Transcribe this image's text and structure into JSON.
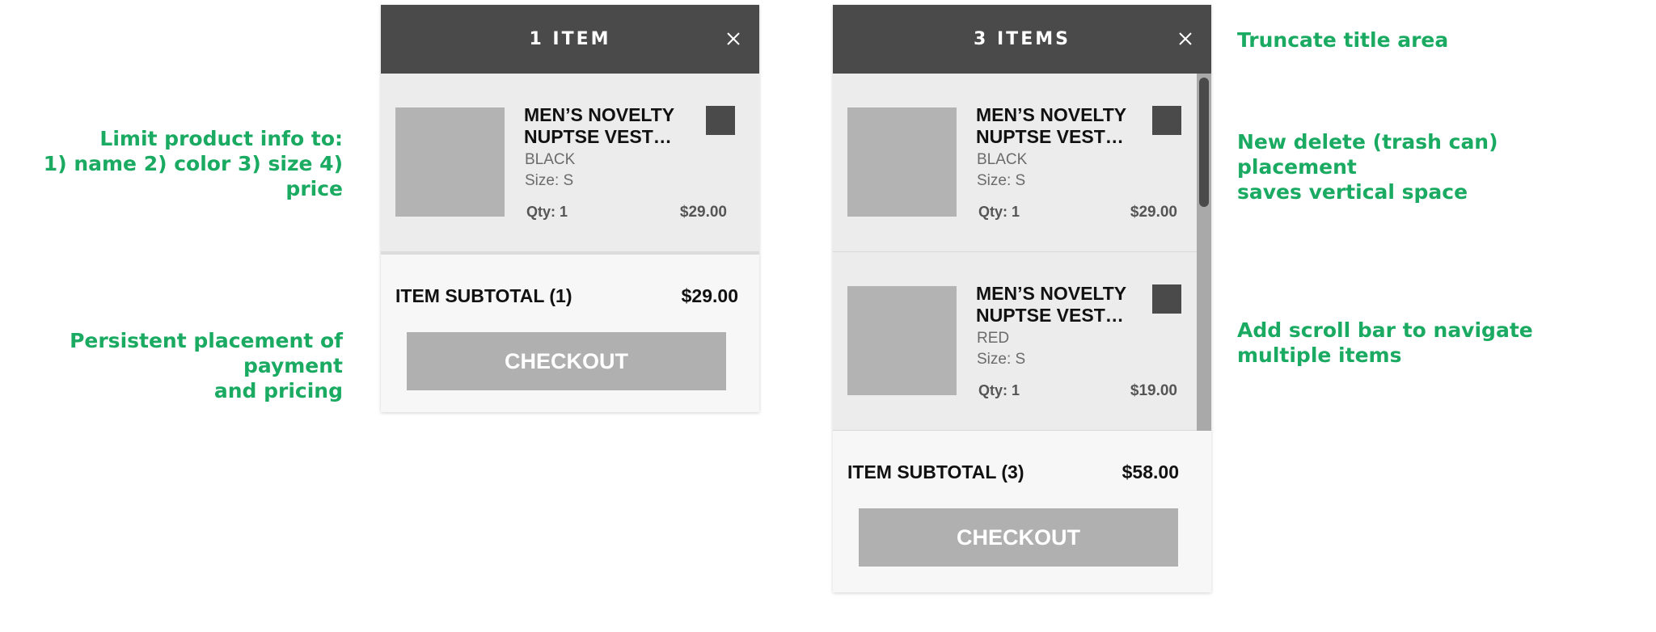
{
  "annotations": {
    "limit_info": [
      "Limit product info to:",
      "1) name 2) color 3) size 4) price"
    ],
    "persistent": [
      "Persistent placement of payment",
      "and pricing"
    ],
    "truncate": [
      "Truncate title area"
    ],
    "delete_placement": [
      "New delete (trash can)",
      "placement",
      "saves vertical space"
    ],
    "scroll_bar": [
      "Add scroll bar to navigate",
      "multiple items"
    ]
  },
  "cart_single": {
    "title": "1 ITEM",
    "close_icon": "close-icon",
    "items": [
      {
        "name_line1": "MEN’S NOVELTY",
        "name_line2": "NUPTSE VEST…",
        "color": "BLACK",
        "size": "Size: S",
        "qty": "Qty: 1",
        "price": "$29.00",
        "delete_icon": "trash-icon"
      }
    ],
    "subtotal_label": "ITEM SUBTOTAL (1)",
    "subtotal_value": "$29.00",
    "checkout_label": "CHECKOUT"
  },
  "cart_multi": {
    "title": "3 ITEMS",
    "close_icon": "close-icon",
    "items": [
      {
        "name_line1": "MEN’S NOVELTY",
        "name_line2": "NUPTSE VEST…",
        "color": "BLACK",
        "size": "Size: S",
        "qty": "Qty: 1",
        "price": "$29.00",
        "delete_icon": "trash-icon"
      },
      {
        "name_line1": "MEN’S NOVELTY",
        "name_line2": "NUPTSE VEST…",
        "color": "RED",
        "size": "Size: S",
        "qty": "Qty: 1",
        "price": "$19.00",
        "delete_icon": "trash-icon"
      }
    ],
    "subtotal_label": "ITEM SUBTOTAL (3)",
    "subtotal_value": "$58.00",
    "checkout_label": "CHECKOUT",
    "scrollbar": "visible"
  },
  "colors": {
    "annotation_green": "#1aaa62",
    "header_dark": "#4a4a4a",
    "item_bg": "#ececec",
    "footer_bg": "#f7f7f7",
    "checkout_bg": "#b0b0b0",
    "placeholder_gray": "#b3b3b3"
  }
}
